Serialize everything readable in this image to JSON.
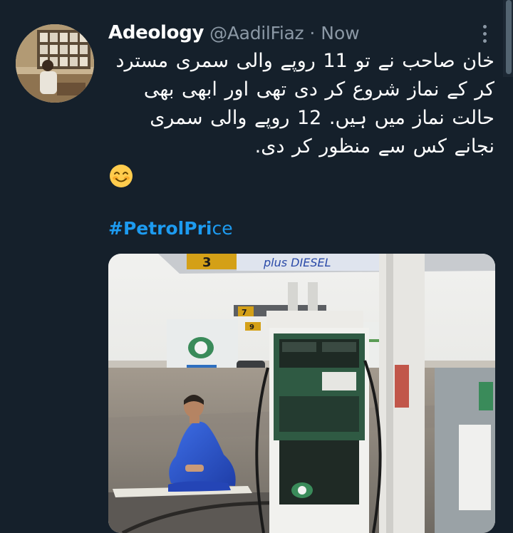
{
  "tweet": {
    "display_name": "Adeology",
    "handle": "@AadilFiaz",
    "separator": "·",
    "timestamp": "Now",
    "text": "خان صاحب نے تو 11 روپے والی سمری مسترد کر کے نماز شروع کر دی تھی اور ابھی بھی حالت نماز میں ہیں. 12 روپے والی سمری نجانے کس سے منظور کر دی.",
    "hashtag": {
      "bold_part": "#PetrolPri",
      "rest": "ce"
    },
    "photo_sign_text": "plus  DIESEL",
    "pump_number_1": "3",
    "pump_number_2": "7",
    "pump_number_3": "9"
  },
  "icons": {
    "more": "more-options-icon",
    "emoji": "smiling-face-emoji-icon"
  },
  "colors": {
    "background": "#15202b",
    "primary_text": "#ffffff",
    "secondary_text": "#8b98a5",
    "link": "#1d9bf0"
  }
}
